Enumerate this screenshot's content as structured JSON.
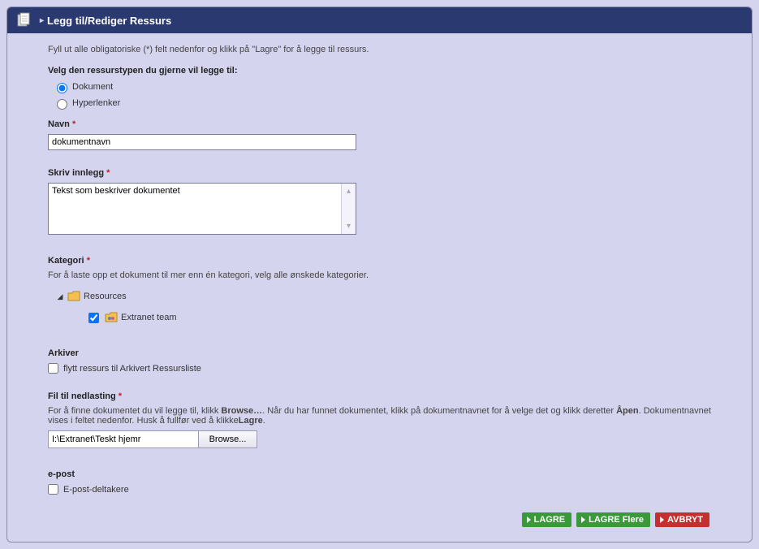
{
  "header": {
    "title": "Legg til/Rediger Ressurs"
  },
  "intro": "Fyll ut alle obligatoriske (*) felt nedenfor og klikk på \"Lagre\" for å legge til ressurs.",
  "resourceType": {
    "label": "Velg den ressurstypen du gjerne vil legge til:",
    "options": {
      "document": "Dokument",
      "hyperlinks": "Hyperlenker"
    }
  },
  "name": {
    "label": "Navn",
    "value": "dokumentnavn"
  },
  "post": {
    "label": "Skriv innlegg",
    "value": "Tekst som beskriver dokumentet"
  },
  "category": {
    "label": "Kategori",
    "helper": "For å laste opp et dokument til mer enn én kategori, velg alle ønskede kategorier.",
    "root": "Resources",
    "child": "Extranet team"
  },
  "archive": {
    "label": "Arkiver",
    "checkbox": "flytt ressurs til Arkivert Ressursliste"
  },
  "download": {
    "label": "Fil til nedlasting",
    "helper_pre": "For å finne dokumentet du vil legge til, klikk ",
    "helper_browse": "Browse…",
    "helper_mid": ". Når du har funnet dokumentet, klikk på dokumentnavnet for å velge det og klikk deretter ",
    "helper_open": "Åpen",
    "helper_mid2": ". Dokumentnavnet vises i feltet nedenfor. Husk å fullfør ved å klikke",
    "helper_save": "Lagre",
    "helper_end": ".",
    "path": "I:\\Extranet\\Teskt hjemr",
    "browse": "Browse..."
  },
  "email": {
    "label": "e-post",
    "checkbox": "E-post-deltakere"
  },
  "buttons": {
    "save": "LAGRE",
    "saveMore": "LAGRE Flere",
    "cancel": "AVBRYT"
  },
  "asterisk": "*"
}
